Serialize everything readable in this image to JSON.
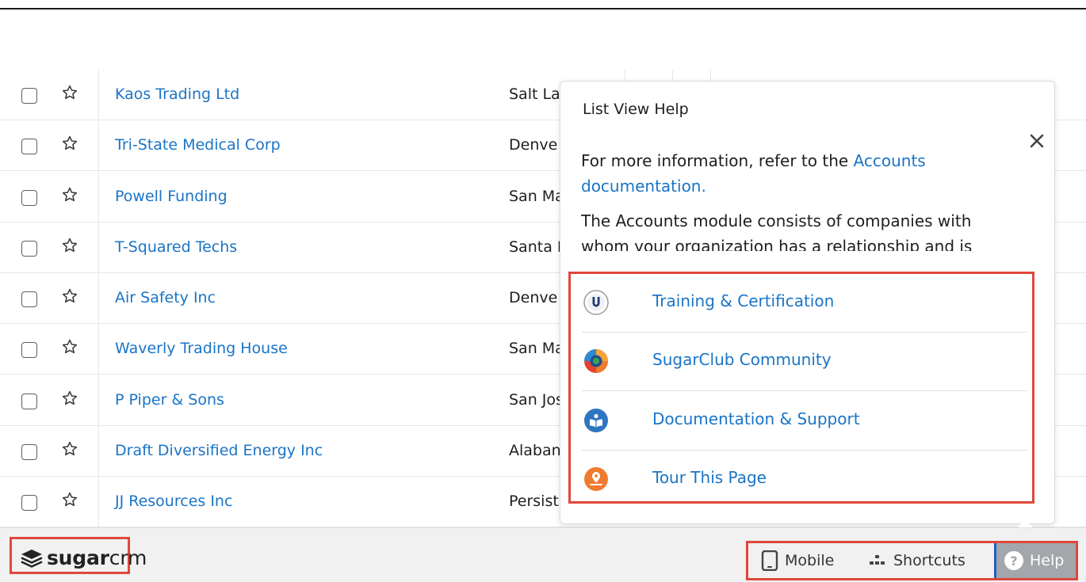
{
  "accounts": [
    {
      "name": "Kaos Trading Ltd",
      "city": "Salt La"
    },
    {
      "name": "Tri-State Medical Corp",
      "city": "Denve"
    },
    {
      "name": "Powell Funding",
      "city": "San Ma"
    },
    {
      "name": "T-Squared Techs",
      "city": "Santa I"
    },
    {
      "name": "Air Safety Inc",
      "city": "Denve"
    },
    {
      "name": "Waverly Trading House",
      "city": "San Ma"
    },
    {
      "name": "P Piper & Sons",
      "city": "San Jos"
    },
    {
      "name": "Draft Diversified Energy Inc",
      "city": "Alaban"
    },
    {
      "name": "JJ Resources Inc",
      "city": "Persist"
    }
  ],
  "popover": {
    "title": "List View Help",
    "intro_text": "For more information, refer to the ",
    "intro_link": "Accounts documentation.",
    "description": "The Accounts module consists of companies with whom your organization has a relationship and is",
    "links": [
      {
        "label": "Training & Certification",
        "icon": "university-icon",
        "color": "#1f3a6e"
      },
      {
        "label": "SugarClub Community",
        "icon": "sugarclub-icon",
        "color": "#f2893a"
      },
      {
        "label": "Documentation & Support",
        "icon": "documentation-icon",
        "color": "#2f76c0"
      },
      {
        "label": "Tour This Page",
        "icon": "tour-icon",
        "color": "#f07a30"
      }
    ]
  },
  "footer": {
    "logo_bold": "sugar",
    "logo_light": "crm",
    "mobile_label": "Mobile",
    "shortcuts_label": "Shortcuts",
    "help_label": "Help",
    "help_glyph": "?"
  },
  "colors": {
    "link": "#1a74c6",
    "highlight": "#e0473b",
    "help_bg": "#a3a6ab",
    "footer_bg": "#f1f1f1"
  }
}
